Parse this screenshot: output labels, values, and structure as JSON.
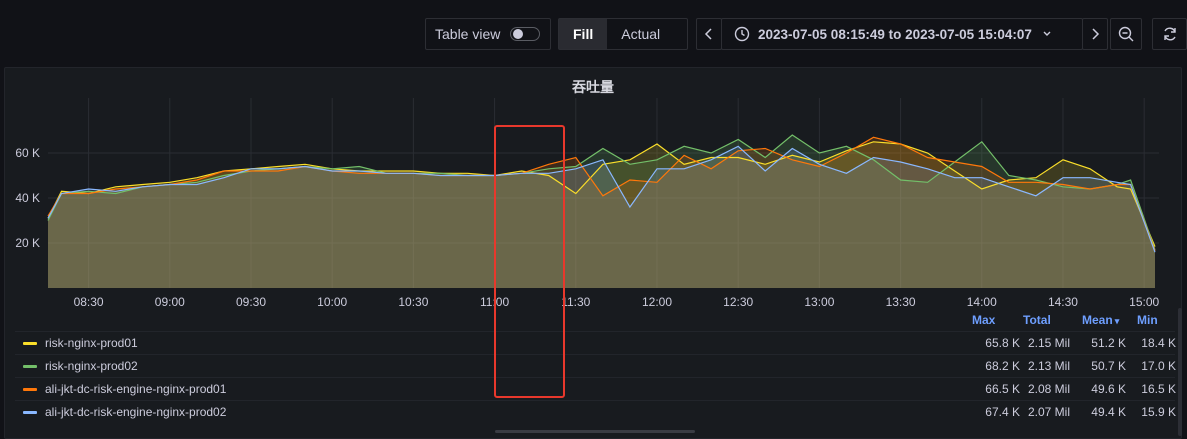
{
  "toolbar": {
    "table_view_label": "Table view",
    "table_view_on": false,
    "fill_label": "Fill",
    "actual_label": "Actual",
    "active_mode": "Fill",
    "time_range": "2023-07-05 08:15:49 to 2023-07-05 15:04:07",
    "icons": [
      "chevron-left-icon",
      "clock-icon",
      "chevron-down-icon",
      "chevron-right-icon",
      "zoom-out-icon",
      "refresh-icon"
    ]
  },
  "panel": {
    "title": "吞吐量"
  },
  "colors": {
    "background": "#111217",
    "panel": "#181b1f",
    "grid": "#2a2d33",
    "header": "#6e9fff",
    "annotation": "#e8382c"
  },
  "chart_data": {
    "type": "line",
    "title": "吞吐量",
    "fill": "area",
    "x_start": "08:15",
    "x_end": "15:04",
    "xticks": [
      "08:30",
      "09:00",
      "09:30",
      "10:00",
      "10:30",
      "11:00",
      "11:30",
      "12:00",
      "12:30",
      "13:00",
      "13:30",
      "14:00",
      "14:30",
      "15:00"
    ],
    "yticks": [
      "20 K",
      "40 K",
      "60 K"
    ],
    "ylim": [
      0,
      80
    ],
    "y_unit": "K",
    "grid": true,
    "series": [
      {
        "name": "risk-nginx-prod01",
        "color": "#fade2a",
        "times": [
          "08:15",
          "08:20",
          "08:30",
          "08:40",
          "08:50",
          "09:00",
          "09:10",
          "09:20",
          "09:30",
          "09:40",
          "09:50",
          "10:00",
          "10:10",
          "10:20",
          "10:30",
          "10:40",
          "10:50",
          "11:00",
          "11:10",
          "11:20",
          "11:30",
          "11:40",
          "11:50",
          "12:00",
          "12:10",
          "12:20",
          "12:30",
          "12:40",
          "12:50",
          "13:00",
          "13:10",
          "13:20",
          "13:30",
          "13:40",
          "13:50",
          "14:00",
          "14:10",
          "14:20",
          "14:30",
          "14:40",
          "14:50",
          "14:55",
          "15:04"
        ],
        "values": [
          31,
          43,
          42,
          45,
          46,
          47,
          49,
          52,
          53,
          54,
          55,
          53,
          52,
          52,
          52,
          51,
          51,
          50,
          52,
          50,
          42,
          55,
          57,
          64,
          55,
          58,
          58,
          55,
          59,
          56,
          61,
          65,
          64,
          60,
          52,
          44,
          48,
          49,
          57,
          53,
          45,
          44,
          18.4
        ]
      },
      {
        "name": "risk-nginx-prod02",
        "color": "#73bf69",
        "times": [
          "08:15",
          "08:20",
          "08:30",
          "08:40",
          "08:50",
          "09:00",
          "09:10",
          "09:20",
          "09:30",
          "09:40",
          "09:50",
          "10:00",
          "10:10",
          "10:20",
          "10:30",
          "10:40",
          "10:50",
          "11:00",
          "11:10",
          "11:20",
          "11:30",
          "11:40",
          "11:50",
          "12:00",
          "12:10",
          "12:20",
          "12:30",
          "12:40",
          "12:50",
          "13:00",
          "13:10",
          "13:20",
          "13:30",
          "13:40",
          "13:50",
          "14:00",
          "14:10",
          "14:20",
          "14:30",
          "14:40",
          "14:50",
          "14:55",
          "15:04"
        ],
        "values": [
          30,
          42,
          43,
          42,
          45,
          46,
          47,
          50,
          52,
          53,
          54,
          53,
          54,
          51,
          51,
          51,
          50,
          50,
          51,
          53,
          54,
          62,
          55,
          57,
          63,
          60,
          66,
          58,
          68,
          60,
          63,
          57,
          48,
          47,
          56,
          65,
          50,
          48,
          45,
          44,
          46,
          48,
          17.0
        ]
      },
      {
        "name": "ali-jkt-dc-risk-engine-nginx-prod01",
        "color": "#ff780a",
        "times": [
          "08:15",
          "08:20",
          "08:30",
          "08:40",
          "08:50",
          "09:00",
          "09:10",
          "09:20",
          "09:30",
          "09:40",
          "09:50",
          "10:00",
          "10:10",
          "10:20",
          "10:30",
          "10:40",
          "10:50",
          "11:00",
          "11:10",
          "11:20",
          "11:30",
          "11:40",
          "11:50",
          "12:00",
          "12:10",
          "12:20",
          "12:30",
          "12:40",
          "12:50",
          "13:00",
          "13:10",
          "13:20",
          "13:30",
          "13:40",
          "13:50",
          "14:00",
          "14:10",
          "14:20",
          "14:30",
          "14:40",
          "14:50",
          "14:55",
          "15:04"
        ],
        "values": [
          32,
          42,
          42,
          44,
          45,
          46,
          48,
          52,
          52,
          52,
          54,
          52,
          51,
          51,
          51,
          50,
          50,
          50,
          51,
          55,
          58,
          41,
          48,
          47,
          59,
          53,
          61,
          62,
          57,
          54,
          60,
          67,
          64,
          58,
          56,
          54,
          47,
          47,
          46,
          44,
          46,
          46,
          16.5
        ]
      },
      {
        "name": "ali-jkt-dc-risk-engine-nginx-prod02",
        "color": "#8ab8ff",
        "times": [
          "08:15",
          "08:20",
          "08:30",
          "08:40",
          "08:50",
          "09:00",
          "09:10",
          "09:20",
          "09:30",
          "09:40",
          "09:50",
          "10:00",
          "10:10",
          "10:20",
          "10:30",
          "10:40",
          "10:50",
          "11:00",
          "11:10",
          "11:20",
          "11:30",
          "11:40",
          "11:50",
          "12:00",
          "12:10",
          "12:20",
          "12:30",
          "12:40",
          "12:50",
          "13:00",
          "13:10",
          "13:20",
          "13:30",
          "13:40",
          "13:50",
          "14:00",
          "14:10",
          "14:20",
          "14:30",
          "14:40",
          "14:50",
          "14:55",
          "15:04"
        ],
        "values": [
          31,
          42,
          44,
          43,
          45,
          46,
          46,
          49,
          53,
          53,
          54,
          52,
          52,
          51,
          51,
          50,
          50,
          50,
          51,
          51,
          53,
          57,
          36,
          53,
          53,
          57,
          63,
          52,
          62,
          55,
          51,
          58,
          56,
          53,
          49,
          49,
          45,
          41,
          49,
          49,
          47,
          46,
          15.9
        ]
      }
    ]
  },
  "legend": {
    "headers": {
      "max": "Max",
      "total": "Total",
      "mean": "Mean",
      "min": "Min"
    },
    "sort_indicator": "▾",
    "rows": [
      {
        "name": "risk-nginx-prod01",
        "color": "#fade2a",
        "max": "65.8 K",
        "total": "2.15 Mil",
        "mean": "51.2 K",
        "min": "18.4 K"
      },
      {
        "name": "risk-nginx-prod02",
        "color": "#73bf69",
        "max": "68.2 K",
        "total": "2.13 Mil",
        "mean": "50.7 K",
        "min": "17.0 K"
      },
      {
        "name": "ali-jkt-dc-risk-engine-nginx-prod01",
        "color": "#ff780a",
        "max": "66.5 K",
        "total": "2.08 Mil",
        "mean": "49.6 K",
        "min": "16.5 K"
      },
      {
        "name": "ali-jkt-dc-risk-engine-nginx-prod02",
        "color": "#8ab8ff",
        "max": "67.4 K",
        "total": "2.07 Mil",
        "mean": "49.4 K",
        "min": "15.9 K"
      }
    ]
  }
}
